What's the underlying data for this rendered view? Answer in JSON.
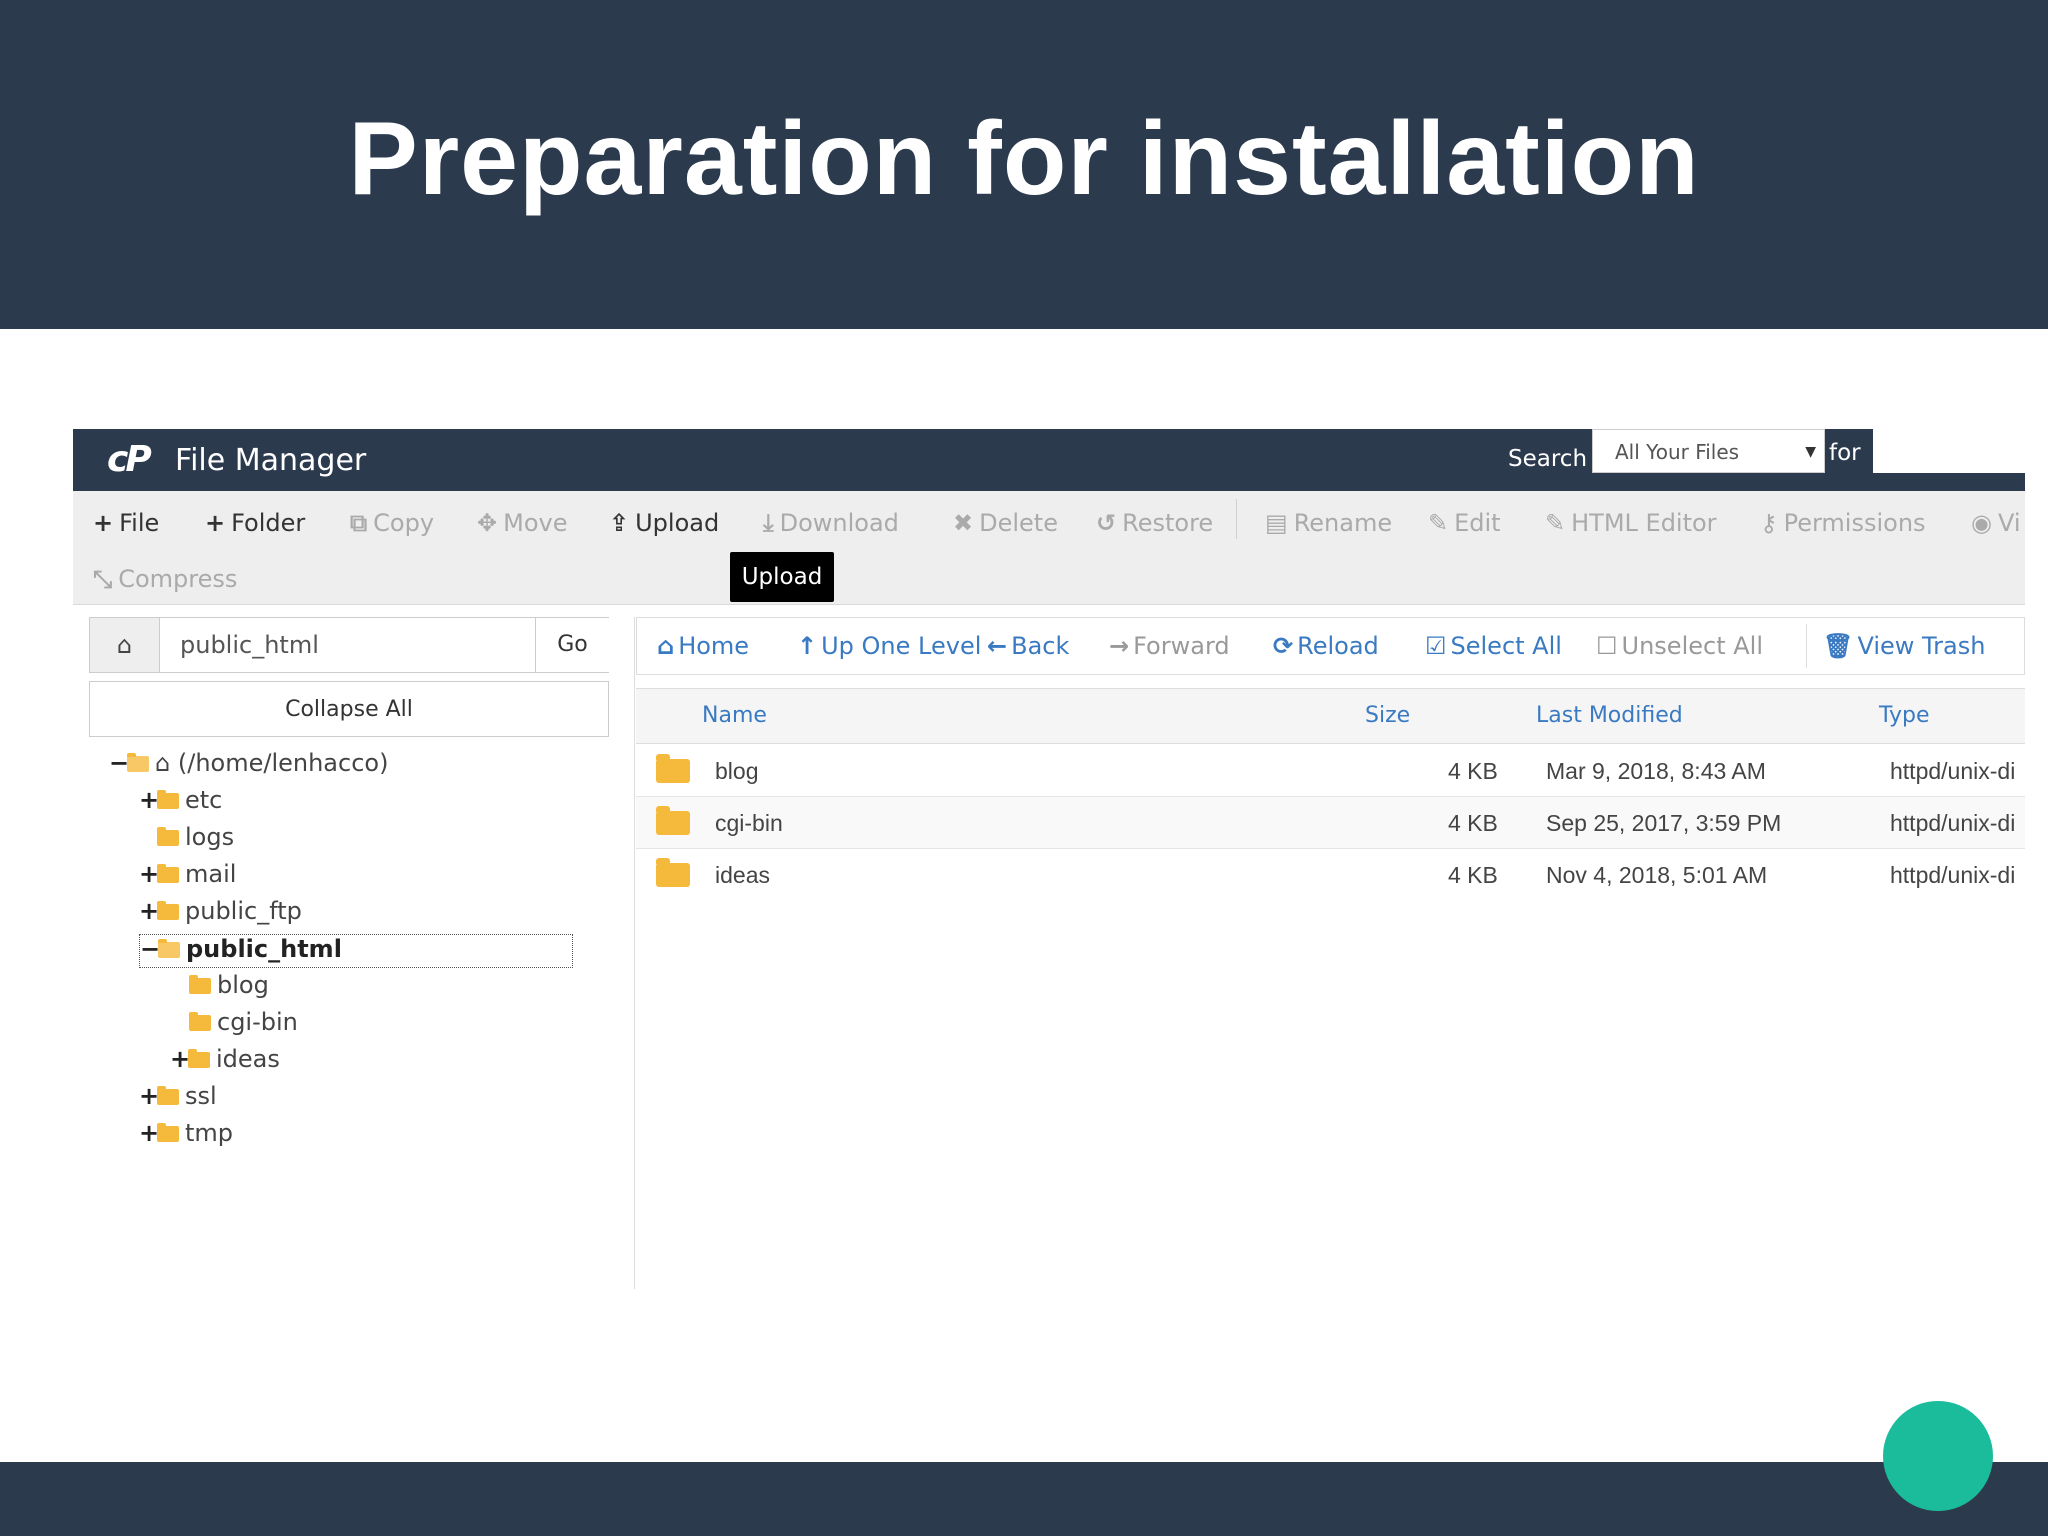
{
  "slide": {
    "title": "Preparation for installation",
    "accent_color": "#1abc9c",
    "header_color": "#2c3a4e"
  },
  "app": {
    "logo": "cP",
    "title": "File Manager",
    "search_label": "Search",
    "search_scope": "All Your Files",
    "search_for": "for",
    "search_value": ""
  },
  "toolbar": {
    "file": "File",
    "folder": "Folder",
    "copy": "Copy",
    "move": "Move",
    "upload": "Upload",
    "download": "Download",
    "delete": "Delete",
    "restore": "Restore",
    "rename": "Rename",
    "edit": "Edit",
    "html_editor": "HTML Editor",
    "permissions": "Permissions",
    "view": "Vi",
    "compress": "Compress",
    "tooltip": "Upload"
  },
  "path": {
    "value": "public_html",
    "go": "Go",
    "collapse_all": "Collapse All"
  },
  "tree": {
    "root": "(/home/lenhacco)",
    "items": [
      "etc",
      "logs",
      "mail",
      "public_ftp",
      "public_html",
      "blog",
      "cgi-bin",
      "ideas",
      "ssl",
      "tmp"
    ]
  },
  "nav": {
    "home": "Home",
    "up_one_level": "Up One Level",
    "back": "Back",
    "forward": "Forward",
    "reload": "Reload",
    "select_all": "Select All",
    "unselect_all": "Unselect All",
    "view_trash": "View Trash"
  },
  "table": {
    "headers": [
      "Name",
      "Size",
      "Last Modified",
      "Type"
    ],
    "rows": [
      {
        "name": "blog",
        "size": "4 KB",
        "modified": "Mar 9, 2018, 8:43 AM",
        "type": "httpd/unix-di"
      },
      {
        "name": "cgi-bin",
        "size": "4 KB",
        "modified": "Sep 25, 2017, 3:59 PM",
        "type": "httpd/unix-di"
      },
      {
        "name": "ideas",
        "size": "4 KB",
        "modified": "Nov 4, 2018, 5:01 AM",
        "type": "httpd/unix-di"
      }
    ]
  }
}
